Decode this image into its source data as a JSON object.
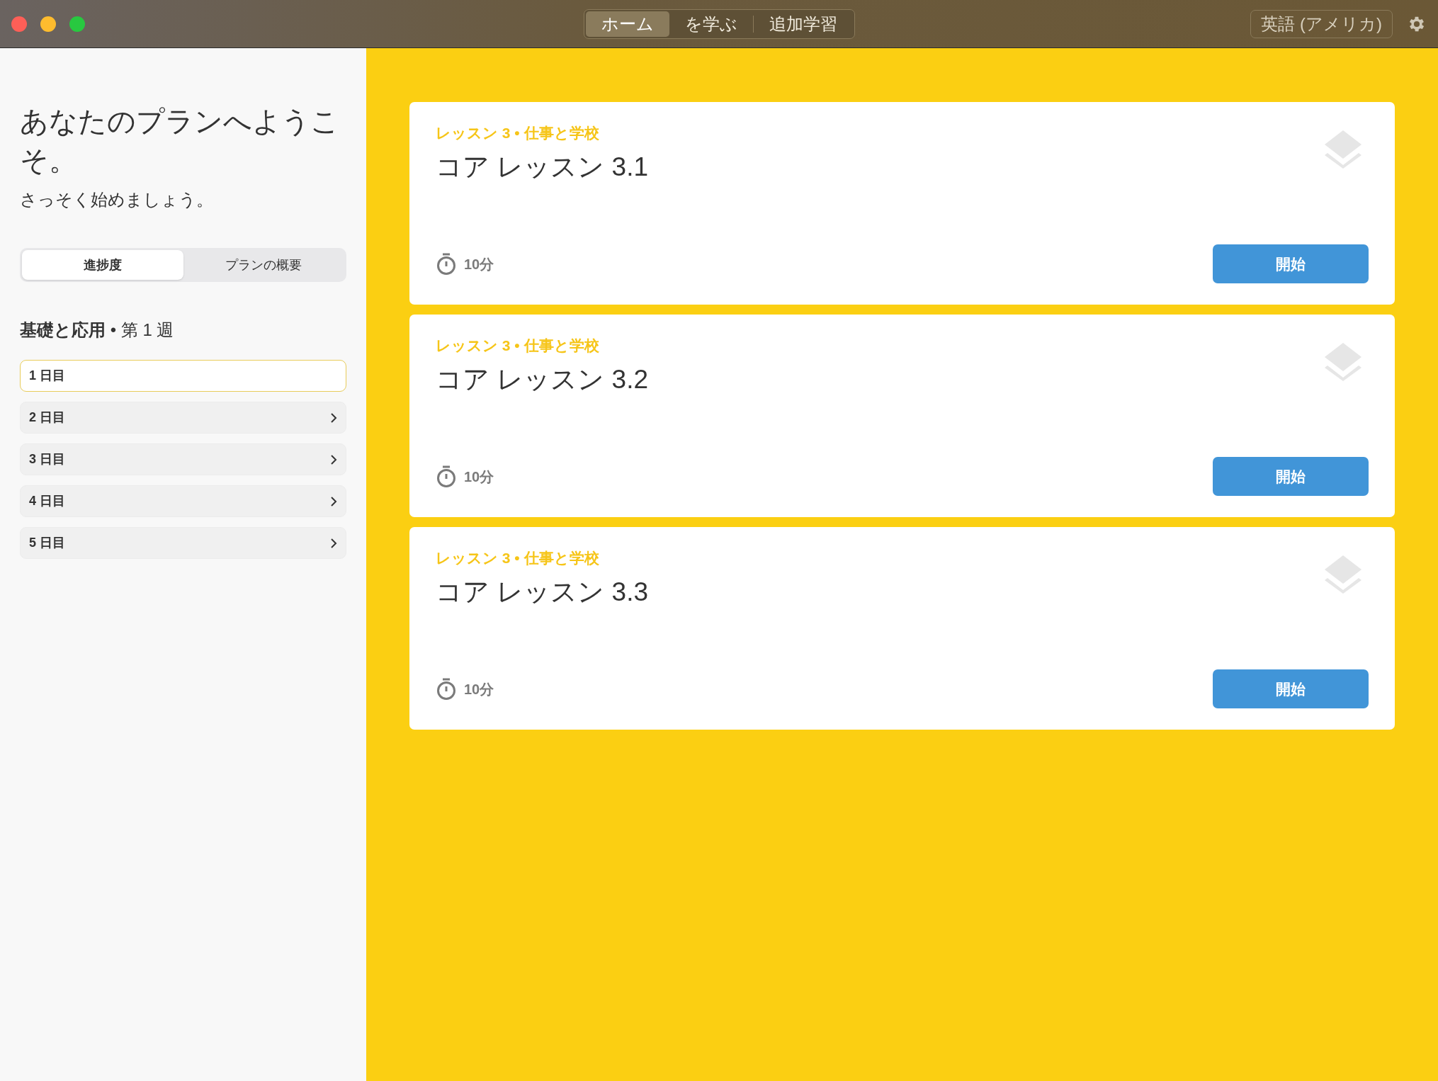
{
  "toolbar": {
    "tabs": [
      {
        "label": "ホーム",
        "selected": true
      },
      {
        "label": "を学ぶ",
        "selected": false
      },
      {
        "label": "追加学習",
        "selected": false
      }
    ],
    "language": "英語 (アメリカ)"
  },
  "sidebar": {
    "title": "あなたのプランへようこそ。",
    "subtitle": "さっそく始めましょう。",
    "segments": [
      {
        "label": "進捗度",
        "selected": true
      },
      {
        "label": "プランの概要",
        "selected": false
      }
    ],
    "section": "**基礎と応用** • 第 1 週",
    "days": [
      {
        "label": "1 日目",
        "selected": true
      },
      {
        "label": "2 日目",
        "selected": false
      },
      {
        "label": "3 日目",
        "selected": false
      },
      {
        "label": "4 日目",
        "selected": false
      },
      {
        "label": "5 日目",
        "selected": false
      }
    ]
  },
  "lessons": [
    {
      "eyebrow": "レッスン 3 • 仕事と学校",
      "title": "コア レッスン 3.1",
      "duration": "10分",
      "button": "開始"
    },
    {
      "eyebrow": "レッスン 3 • 仕事と学校",
      "title": "コア レッスン 3.2",
      "duration": "10分",
      "button": "開始"
    },
    {
      "eyebrow": "レッスン 3 • 仕事と学校",
      "title": "コア レッスン 3.3",
      "duration": "10分",
      "button": "開始"
    }
  ]
}
